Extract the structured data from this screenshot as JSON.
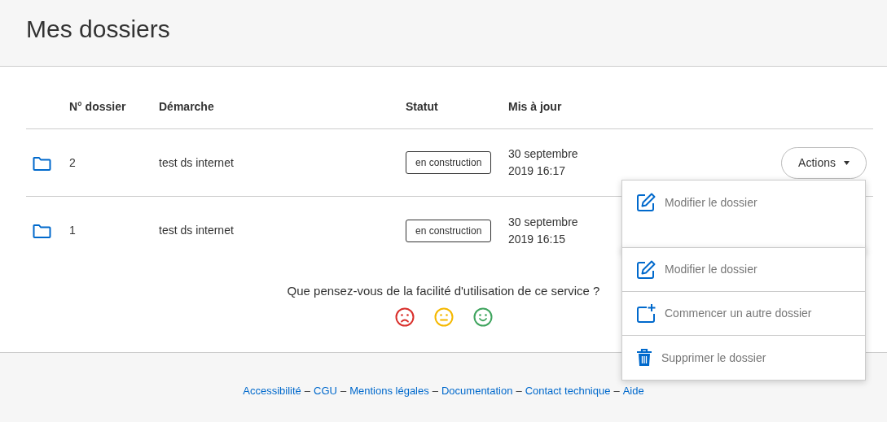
{
  "header": {
    "title": "Mes dossiers"
  },
  "table": {
    "columns": [
      "N° dossier",
      "Démarche",
      "Statut",
      "Mis à jour"
    ],
    "rows": [
      {
        "number": "2",
        "procedure": "test ds internet",
        "status": "en construction",
        "updated": "30 septembre 2019 16:17",
        "actions": "Actions"
      },
      {
        "number": "1",
        "procedure": "test ds internet",
        "status": "en construction",
        "updated": "30 septembre 2019 16:15"
      }
    ]
  },
  "feedback": {
    "question": "Que pensez-vous de la facilité d'utilisation de ce service ?",
    "ratings": [
      {
        "kind": "sad",
        "color": "#d9302c"
      },
      {
        "kind": "neutral",
        "color": "#f5b800"
      },
      {
        "kind": "happy",
        "color": "#3fa45e"
      }
    ]
  },
  "footer": {
    "items": [
      {
        "kind": "link",
        "text": "Accessibilité"
      },
      {
        "kind": "sep",
        "text": "–"
      },
      {
        "kind": "link",
        "text": "CGU"
      },
      {
        "kind": "sep",
        "text": "–"
      },
      {
        "kind": "link",
        "text": "Mentions légales"
      },
      {
        "kind": "sep",
        "text": "–"
      },
      {
        "kind": "link",
        "text": "Documentation"
      },
      {
        "kind": "sep",
        "text": "–"
      },
      {
        "kind": "link",
        "text": "Contact technique"
      },
      {
        "kind": "sep",
        "text": "–"
      },
      {
        "kind": "link",
        "text": "Aide"
      }
    ]
  },
  "menus": [
    {
      "items": [
        {
          "kind": "edit",
          "label": "Modifier le dossier"
        }
      ]
    },
    {
      "items": [
        {
          "kind": "edit",
          "label": "Modifier le dossier"
        },
        {
          "kind": "new",
          "label": "Commencer un autre dossier"
        },
        {
          "kind": "delete",
          "label": "Supprimer le dossier"
        }
      ]
    }
  ]
}
